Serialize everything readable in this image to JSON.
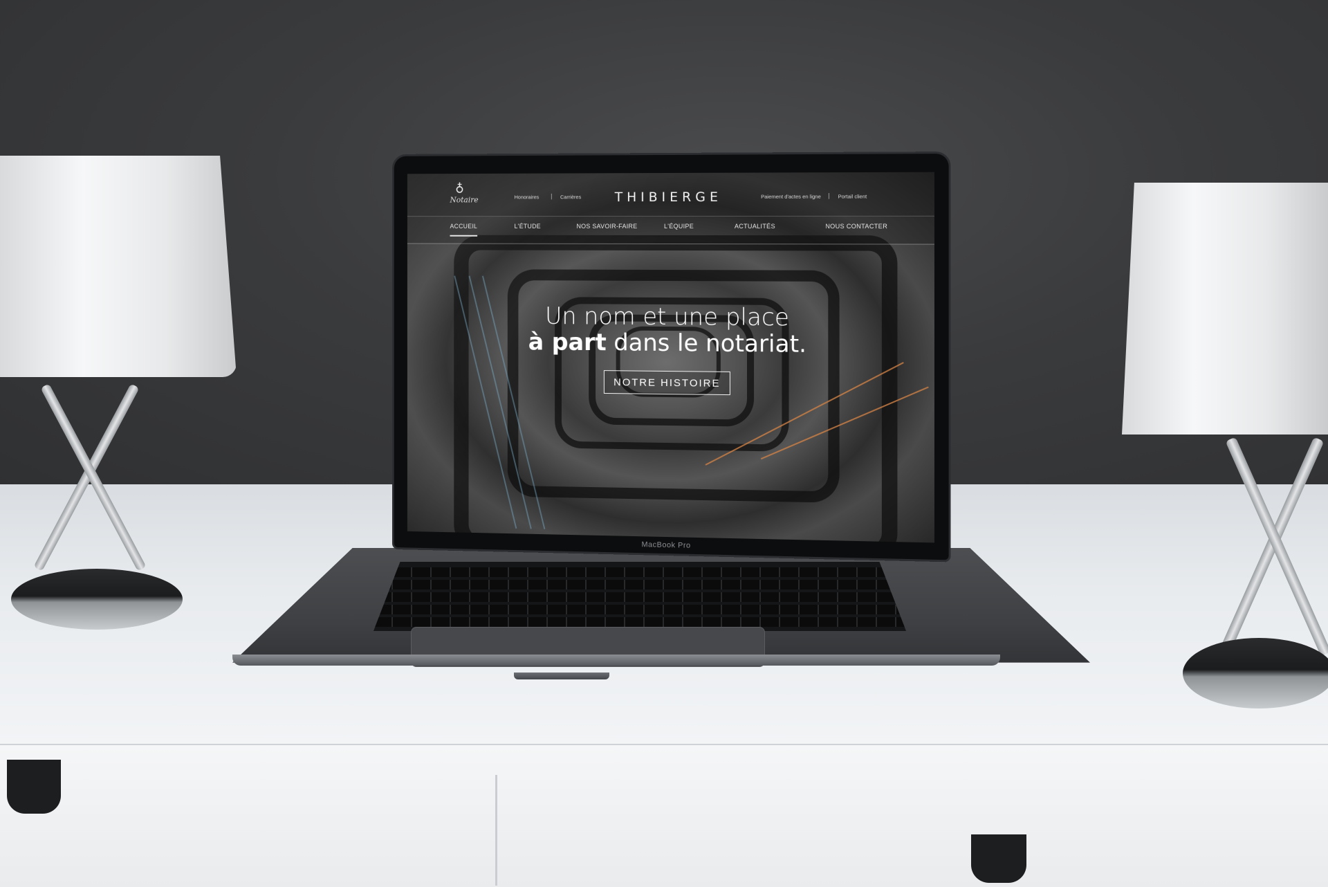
{
  "site": {
    "logo_text": "Notaire",
    "brand": "THIBIERGE",
    "top_links_left": [
      "Honoraires",
      "Carrières"
    ],
    "top_links_right": [
      "Paiement d'actes en ligne",
      "Portail client"
    ],
    "separator": "|",
    "nav": [
      {
        "label": "ACCUEIL",
        "active": true
      },
      {
        "label": "L'ÉTUDE",
        "active": false
      },
      {
        "label": "NOS SAVOIR-FAIRE",
        "active": false
      },
      {
        "label": "L'ÉQUIPE",
        "active": false
      },
      {
        "label": "ACTUALITÉS",
        "active": false
      },
      {
        "label": "NOUS CONTACTER",
        "active": false
      }
    ],
    "hero": {
      "line1": "Un nom et une place",
      "line2_bold": "à part",
      "line2_rest": " dans le notariat.",
      "cta": "NOTRE HISTOIRE"
    }
  },
  "device": {
    "label": "MacBook Pro"
  },
  "colors": {
    "wall": "#3b3c3e",
    "desk": "#eceef0",
    "accent_line": "#d28246"
  }
}
